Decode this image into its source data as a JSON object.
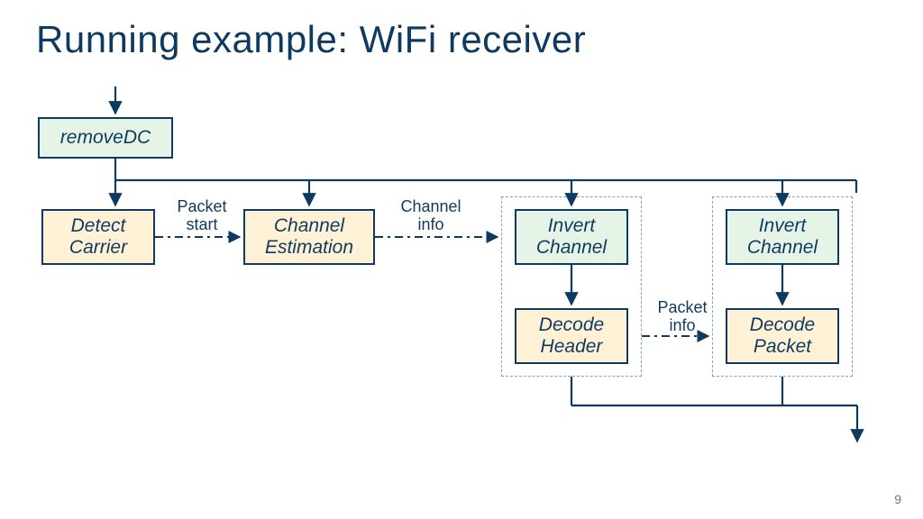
{
  "title": "Running example: WiFi receiver",
  "page_number": "9",
  "nodes": {
    "removeDC": "removeDC",
    "detectCarrier": "Detect\nCarrier",
    "channelEstimation": "Channel\nEstimation",
    "invertChannel1": "Invert\nChannel",
    "decodeHeader": "Decode\nHeader",
    "invertChannel2": "Invert\nChannel",
    "decodePacket": "Decode\nPacket"
  },
  "edge_labels": {
    "packetStart": "Packet\nstart",
    "channelInfo": "Channel\ninfo",
    "packetInfo": "Packet\ninfo"
  },
  "colors": {
    "line": "#0f3a5f",
    "dash": "#0f3a5f"
  }
}
